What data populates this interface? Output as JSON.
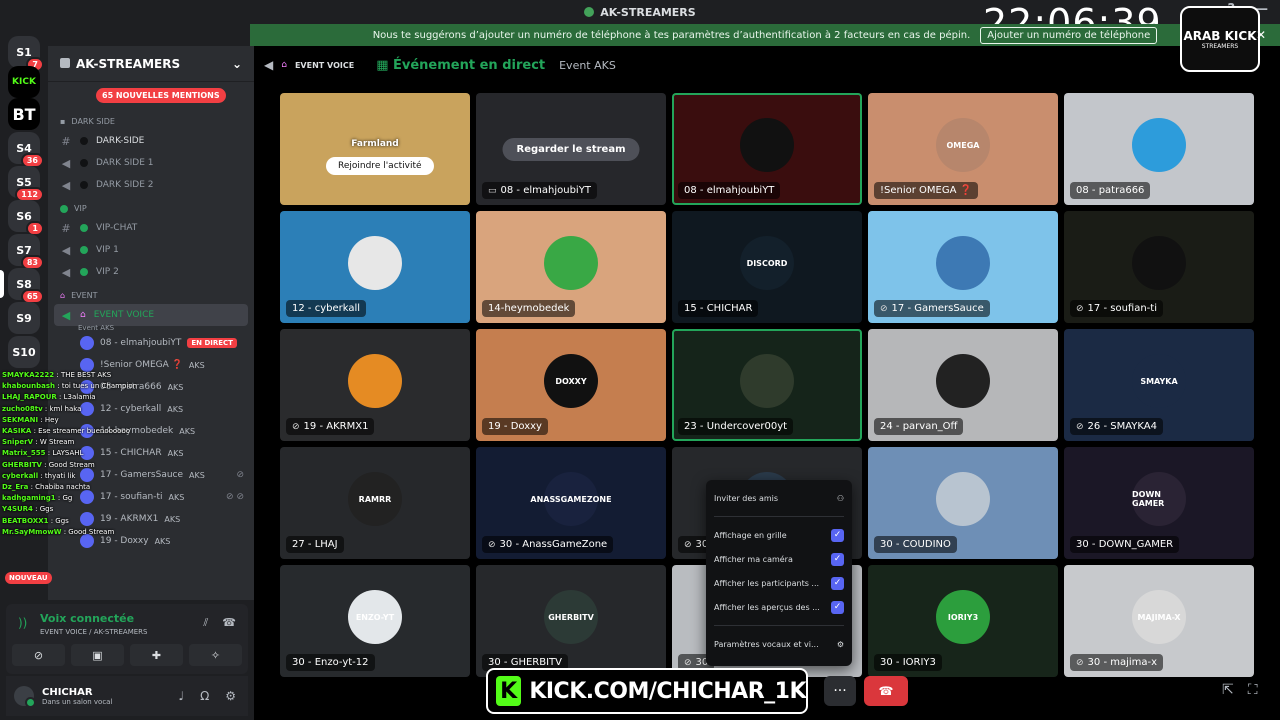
{
  "window": {
    "title": "AK-STREAMERS",
    "clock": "22:06:39"
  },
  "notice": {
    "text": "Nous te suggérons d’ajouter un numéro de téléphone à tes paramètres d’authentification à 2 facteurs en cas de pépin.",
    "button": "Ajouter un numéro de téléphone"
  },
  "rail": {
    "servers": [
      {
        "name": "S1",
        "badge": "7"
      },
      {
        "name": "KICK",
        "badge": ""
      },
      {
        "name": "BT",
        "badge": ""
      },
      {
        "name": "S4",
        "badge": "36"
      },
      {
        "name": "S5",
        "badge": "112"
      },
      {
        "name": "S6",
        "badge": "1"
      },
      {
        "name": "S7",
        "badge": "83"
      },
      {
        "name": "S8",
        "badge": "65"
      },
      {
        "name": "S9",
        "badge": ""
      },
      {
        "name": "S10",
        "badge": ""
      }
    ]
  },
  "sidebar": {
    "server_name": "AK-STREAMERS",
    "mentions": "65 NOUVELLES MENTIONS",
    "cat_dark": "DARK SIDE",
    "ch_dark_side": "DARK-SIDE",
    "ch_dark_side1": "DARK SIDE 1",
    "ch_dark_side2": "DARK SIDE 2",
    "cat_vip": "Vip",
    "ch_vip_chat": "VIP-CHAT",
    "ch_vip1": "VIP 1",
    "ch_vip2": "VIP 2",
    "cat_event": "Event",
    "ch_event_voice": "EVENT VOICE",
    "event_sub": "Event AKS",
    "voice_users": [
      {
        "name": "08 - elmahjoubiYT",
        "tag": "",
        "live": "EN DIRECT",
        "mute": ""
      },
      {
        "name": "!Senior OMEGA ❓",
        "tag": "AKS",
        "live": "",
        "mute": ""
      },
      {
        "name": "08 - patra666",
        "tag": "AKS",
        "live": "",
        "mute": ""
      },
      {
        "name": "12 - cyberkall",
        "tag": "AKS",
        "live": "",
        "mute": ""
      },
      {
        "name": "14-heymobedek",
        "tag": "AKS",
        "live": "",
        "mute": ""
      },
      {
        "name": "15 - CHICHAR",
        "tag": "AKS",
        "live": "",
        "mute": ""
      },
      {
        "name": "17 - GamersSauce",
        "tag": "AKS",
        "live": "",
        "mute": "⊘"
      },
      {
        "name": "17 - soufian-ti",
        "tag": "AKS",
        "live": "",
        "mute": "⊘ ⊘"
      },
      {
        "name": "19 - AKRMX1",
        "tag": "AKS",
        "live": "",
        "mute": ""
      },
      {
        "name": "19 - Doxxy",
        "tag": "AKS",
        "live": "",
        "mute": ""
      }
    ]
  },
  "chat_overlay": [
    {
      "user": "SMAYKA2222",
      "msg": ": THE BEST AKS"
    },
    {
      "user": "khabounbash",
      "msg": ": toi tues un Champion"
    },
    {
      "user": "LHAJ_RAPOUR",
      "msg": ": L3alamia"
    },
    {
      "user": "zucho08tv",
      "msg": ": kml haka"
    },
    {
      "user": "SEKMANI",
      "msg": ": Hey"
    },
    {
      "user": "KASIKA",
      "msg": ": Ese streamer buenoooooo"
    },
    {
      "user": "SniperV",
      "msg": ": W Stream"
    },
    {
      "user": "Matrix_555",
      "msg": ": LAYSAHL"
    },
    {
      "user": "GHERBITV",
      "msg": ": Good Stream"
    },
    {
      "user": "cyberkall",
      "msg": ": thyati lik"
    },
    {
      "user": "Dz_Era",
      "msg": ": Chabiba nachta"
    },
    {
      "user": "kadhgaming1",
      "msg": ": Gg"
    },
    {
      "user": "Y4SUR4",
      "msg": ": Ggs"
    },
    {
      "user": "BEATBOXX1",
      "msg": ": Ggs"
    },
    {
      "user": "Mr.SayMmowW",
      "msg": ": Good Stream"
    }
  ],
  "new_badge": "NOUVEAU",
  "voice_panel": {
    "title": "Voix connectée",
    "sub": "EVENT VOICE / AK-STREAMERS"
  },
  "me": {
    "name": "CHICHAR",
    "status": "Dans un salon vocal"
  },
  "header": {
    "channel": "EVENT VOICE",
    "event_title": "Événement en direct",
    "event_name": "Event AKS"
  },
  "tiles": [
    {
      "label": "Farmland",
      "bg": "#c9a35d",
      "type": "activity",
      "button": "Rejoindre l'activité"
    },
    {
      "label": "08 - elmahjoubiYT",
      "bg": "#26272b",
      "type": "stream",
      "button": "Regarder le stream",
      "icon": "▭"
    },
    {
      "label": "08 - elmahjoubiYT",
      "bg": "#3a0d0e",
      "type": "cam",
      "speak": true,
      "avatar": "",
      "avbg": "#111"
    },
    {
      "label": "!Senior OMEGA ❓",
      "bg": "#c98e6e",
      "type": "cam",
      "avatar": "OMEGA",
      "avbg": "#b7866c"
    },
    {
      "label": "08 - patra666",
      "bg": "#c3c6cb",
      "type": "cam",
      "avatar": "",
      "avbg": "#2d9cdb"
    },
    {
      "label": "12 - cyberkall",
      "bg": "#2c7fb7",
      "type": "cam",
      "avatar": "",
      "avbg": "#e7e7e7"
    },
    {
      "label": "14-heymobedek",
      "bg": "#d9a47d",
      "type": "cam",
      "avatar": "",
      "avbg": "#39a845"
    },
    {
      "label": "15 - CHICHAR",
      "bg": "#0f1820",
      "type": "cam",
      "avatar": "DISCORD",
      "avbg": "#13202b"
    },
    {
      "label": "17 - GamersSauce",
      "bg": "#7ec3ea",
      "type": "cam",
      "avatar": "",
      "avbg": "#3d79b4",
      "mute": "⊘"
    },
    {
      "label": "17 - soufian-ti",
      "bg": "#1a1c16",
      "type": "cam",
      "avatar": "",
      "avbg": "#111",
      "mute": "⊘"
    },
    {
      "label": "19 - AKRMX1",
      "bg": "#2a2b2d",
      "type": "cam",
      "avatar": "",
      "avbg": "#e58b23",
      "mute": "⊘"
    },
    {
      "label": "19 - Doxxy",
      "bg": "#c57e4f",
      "type": "cam",
      "avatar": "DOXXY",
      "avbg": "#111"
    },
    {
      "label": "23 - Undercover00yt",
      "bg": "#15241a",
      "type": "cam",
      "speak": true,
      "avatar": "",
      "avbg": "#2f3b2c"
    },
    {
      "label": "24 - parvan_Off",
      "bg": "#b6b7b9",
      "type": "cam",
      "avatar": "",
      "avbg": "#222"
    },
    {
      "label": "26 - SMAYKA4",
      "bg": "#1b2a44",
      "type": "cam",
      "avatar": "SMAYKA",
      "avbg": "#1b2a44",
      "mute": "⊘"
    },
    {
      "label": "27 - LHAJ",
      "bg": "#26282b",
      "type": "cam",
      "avatar": "RAMRR",
      "avbg": "#222"
    },
    {
      "label": "30 - AnassGameZone",
      "bg": "#131c33",
      "type": "cam",
      "avatar": "ANASSGAMEZONE",
      "avbg": "#19223e",
      "mute": "⊘"
    },
    {
      "label": "30",
      "bg": "#26282b",
      "type": "cam",
      "avatar": "",
      "avbg": "#2a3a4a",
      "mute": "⊘"
    },
    {
      "label": "30 - COUDINO",
      "bg": "#6e8fb6",
      "type": "cam",
      "avatar": "",
      "avbg": "#b8c4d0"
    },
    {
      "label": "30 - DOWN_GAMER",
      "bg": "#1b1726",
      "type": "cam",
      "avatar": "DOWN GAMER",
      "avbg": "#2a2334"
    },
    {
      "label": "30 - Enzo-yt-12",
      "bg": "#272a2d",
      "type": "cam",
      "avatar": "ENZO-YT",
      "avbg": "#e3e7ea"
    },
    {
      "label": "30 - GHERBITV",
      "bg": "#26282b",
      "type": "cam",
      "avatar": "GHERBITV",
      "avbg": "#2c3a36"
    },
    {
      "label": "30",
      "bg": "#b9bcc0",
      "type": "cam",
      "avatar": "",
      "avbg": "#999",
      "mute": "⊘"
    },
    {
      "label": "30 - IORIY3",
      "bg": "#17251a",
      "type": "cam",
      "avatar": "IORIY3",
      "avbg": "#2c9e3d"
    },
    {
      "label": "30 - majima-x",
      "bg": "#c7c9cc",
      "type": "cam",
      "avatar": "MAJIMA-X",
      "avbg": "#d8d8d8",
      "mute": "⊘"
    }
  ],
  "menu": {
    "invite": "Inviter des amis",
    "grid": "Affichage en grille",
    "camera": "Afficher ma caméra",
    "participants": "Afficher les participants ...",
    "previews": "Afficher les aperçus des ...",
    "settings": "Paramètres vocaux et vi..."
  },
  "kick": {
    "url": "KICK.COM/CHICHAR_1K"
  },
  "logo": {
    "line1": "ARAB KICK",
    "line2": "STREAMERS"
  }
}
